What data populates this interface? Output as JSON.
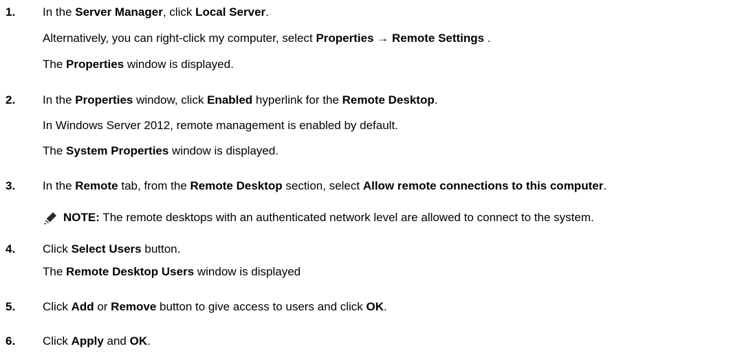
{
  "steps": [
    {
      "number": "1.",
      "lines": [
        [
          {
            "t": "In the "
          },
          {
            "t": "Server Manager",
            "b": true
          },
          {
            "t": ", click "
          },
          {
            "t": "Local Server",
            "b": true
          },
          {
            "t": "."
          }
        ],
        [
          {
            "t": "Alternatively, you can right-click my computer, select "
          },
          {
            "t": "Properties",
            "b": true
          },
          {
            "t": " → "
          },
          {
            "t": "Remote Settings",
            "b": true
          },
          {
            "t": " ."
          }
        ],
        [
          {
            "t": "The "
          },
          {
            "t": "Properties",
            "b": true
          },
          {
            "t": " window is displayed."
          }
        ]
      ]
    },
    {
      "number": "2.",
      "lines": [
        [
          {
            "t": "In the "
          },
          {
            "t": "Properties",
            "b": true
          },
          {
            "t": " window, click "
          },
          {
            "t": "Enabled",
            "b": true
          },
          {
            "t": " hyperlink for the "
          },
          {
            "t": "Remote Desktop",
            "b": true
          },
          {
            "t": "."
          }
        ],
        [
          {
            "t": "In Windows Server 2012, remote management is enabled by default."
          }
        ],
        [
          {
            "t": "The "
          },
          {
            "t": "System Properties",
            "b": true
          },
          {
            "t": " window is displayed."
          }
        ]
      ]
    },
    {
      "number": "3.",
      "lines": [
        [
          {
            "t": "In the "
          },
          {
            "t": "Remote",
            "b": true
          },
          {
            "t": " tab, from the "
          },
          {
            "t": "Remote Desktop",
            "b": true
          },
          {
            "t": " section, select "
          },
          {
            "t": "Allow remote connections to this computer",
            "b": true
          },
          {
            "t": "."
          }
        ]
      ],
      "note": {
        "icon": "pencil-note-icon",
        "label": "NOTE:",
        "text": " The remote desktops with an authenticated network level are allowed to connect to the system."
      }
    },
    {
      "number": "4.",
      "lines": [
        [
          {
            "t": "Click "
          },
          {
            "t": "Select Users",
            "b": true
          },
          {
            "t": " button."
          }
        ],
        [
          {
            "t": "The "
          },
          {
            "t": "Remote Desktop Users",
            "b": true
          },
          {
            "t": " window is displayed"
          }
        ]
      ]
    },
    {
      "number": "5.",
      "lines": [
        [
          {
            "t": "Click "
          },
          {
            "t": "Add",
            "b": true
          },
          {
            "t": " or "
          },
          {
            "t": "Remove",
            "b": true
          },
          {
            "t": " button to give access to users and click "
          },
          {
            "t": "OK",
            "b": true
          },
          {
            "t": "."
          }
        ]
      ]
    },
    {
      "number": "6.",
      "lines": [
        [
          {
            "t": "Click "
          },
          {
            "t": "Apply",
            "b": true
          },
          {
            "t": " and "
          },
          {
            "t": "OK",
            "b": true
          },
          {
            "t": "."
          }
        ]
      ]
    }
  ]
}
